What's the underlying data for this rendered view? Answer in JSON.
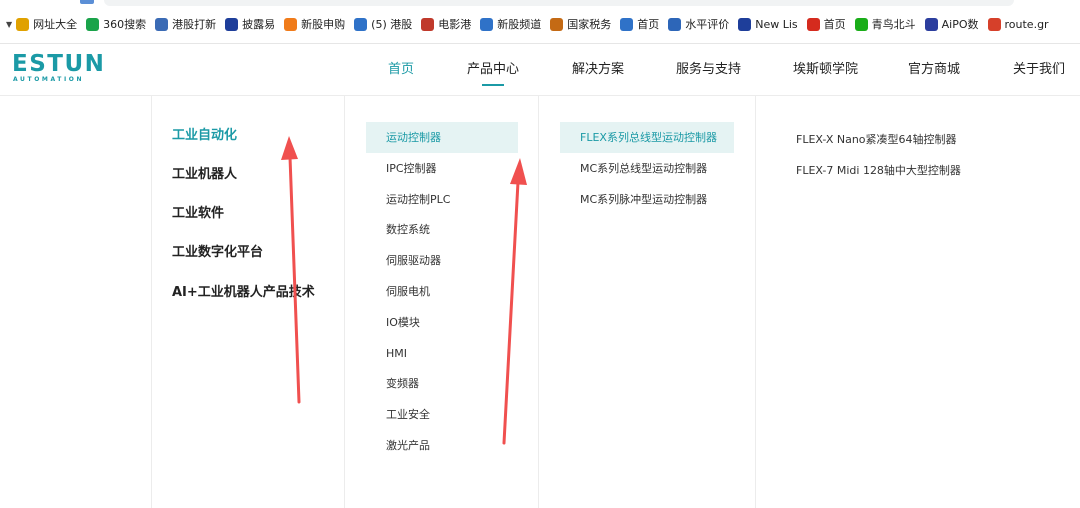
{
  "bookmarks": {
    "items": [
      {
        "label": "网址大全",
        "icon": "globe-icon",
        "color": "#e0a100"
      },
      {
        "label": "360搜索",
        "icon": "search360-icon",
        "color": "#1aa34a"
      },
      {
        "label": "港股打新",
        "icon": "stock-icon",
        "color": "#3b6bb5"
      },
      {
        "label": "披露易",
        "icon": "cross-icon",
        "color": "#1e3e9a"
      },
      {
        "label": "新股申购",
        "icon": "bird-icon",
        "color": "#f07b1a"
      },
      {
        "label": "(5) 港股",
        "icon": "app-icon",
        "color": "#2f72c8"
      },
      {
        "label": "电影港",
        "icon": "film-icon",
        "color": "#c0392b"
      },
      {
        "label": "新股频道",
        "icon": "mountain-icon",
        "color": "#2f72c8"
      },
      {
        "label": "国家税务",
        "icon": "emblem-icon",
        "color": "#c46a14"
      },
      {
        "label": "首页",
        "icon": "chart-icon",
        "color": "#2f72c8"
      },
      {
        "label": "水平评价",
        "icon": "tree-icon",
        "color": "#2d66b8"
      },
      {
        "label": "New Lis",
        "icon": "x-icon",
        "color": "#1e3e9a"
      },
      {
        "label": "首页",
        "icon": "weibo-icon",
        "color": "#d52b1e"
      },
      {
        "label": "青鸟北斗",
        "icon": "wechat-icon",
        "color": "#1aad19"
      },
      {
        "label": "AiPO数",
        "icon": "aipo-icon",
        "color": "#2c3e9e"
      },
      {
        "label": "route.gr",
        "icon": "diamond-icon",
        "color": "#d6402a"
      }
    ]
  },
  "header": {
    "logo_main": "ESTUN",
    "logo_sub": "AUTOMATION",
    "nav": [
      "首页",
      "产品中心",
      "解决方案",
      "服务与支持",
      "埃斯顿学院",
      "官方商城",
      "关于我们"
    ]
  },
  "menu": {
    "categories": [
      "工业自动化",
      "工业机器人",
      "工业软件",
      "工业数字化平台",
      "AI+工业机器人产品技术"
    ],
    "subcategories": [
      "运动控制器",
      "IPC控制器",
      "运动控制PLC",
      "数控系统",
      "伺服驱动器",
      "伺服电机",
      "IO模块",
      "HMI",
      "变频器",
      "工业安全",
      "激光产品"
    ],
    "series": [
      "FLEX系列总线型运动控制器",
      "MC系列总线型运动控制器",
      "MC系列脉冲型运动控制器"
    ],
    "products": [
      "FLEX-X Nano紧凑型64轴控制器",
      "FLEX-7 Midi 128轴中大型控制器"
    ]
  },
  "colors": {
    "accent": "#1b9aa6",
    "highlight_bg": "#e5f3f3",
    "annotation_arrow": "#f0504f"
  }
}
